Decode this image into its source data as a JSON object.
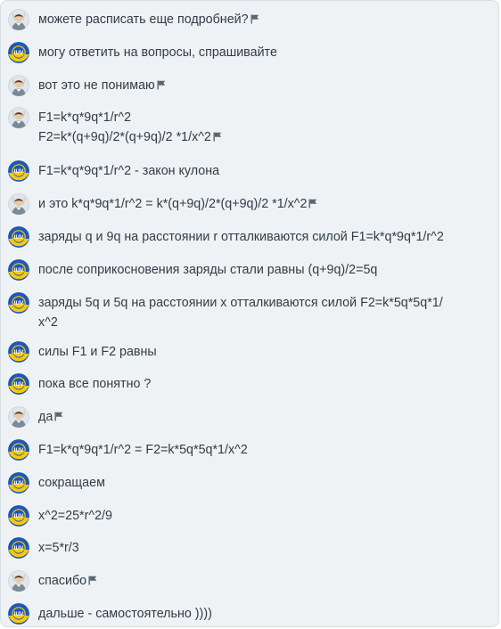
{
  "chat": {
    "messages": [
      {
        "author": "asker",
        "lines": [
          "можете расписать еще подробней?"
        ],
        "flag": true
      },
      {
        "author": "helper",
        "lines": [
          "могу ответить на вопросы, спрашивайте"
        ],
        "flag": false
      },
      {
        "author": "asker",
        "lines": [
          "вот это не понимаю"
        ],
        "flag": true
      },
      {
        "author": "asker",
        "lines": [
          "F1=k*q*9q*1/r^2",
          "F2=k*(q+9q)/2*(q+9q)/2 *1/x^2"
        ],
        "flag": true
      },
      {
        "author": "helper",
        "lines": [
          "F1=k*q*9q*1/r^2 - закон кулона"
        ],
        "flag": false
      },
      {
        "author": "asker",
        "lines": [
          "и это k*q*9q*1/r^2 = k*(q+9q)/2*(q+9q)/2 *1/x^2"
        ],
        "flag": true
      },
      {
        "author": "helper",
        "lines": [
          "заряды q и 9q на расстоянии r отталкиваются силой F1=k*q*9q*1/r^2"
        ],
        "flag": false
      },
      {
        "author": "helper",
        "lines": [
          "после соприкосновения заряды стали равны (q+9q)/2=5q"
        ],
        "flag": false
      },
      {
        "author": "helper",
        "lines": [
          "заряды 5q и 5q на расстоянии x отталкиваются силой F2=k*5q*5q*1/",
          "x^2"
        ],
        "flag": false
      },
      {
        "author": "helper",
        "lines": [
          "силы F1 и F2 равны"
        ],
        "flag": false
      },
      {
        "author": "helper",
        "lines": [
          "пока все понятно ?"
        ],
        "flag": false
      },
      {
        "author": "asker",
        "lines": [
          "да"
        ],
        "flag": true
      },
      {
        "author": "helper",
        "lines": [
          "F1=k*q*9q*1/r^2 = F2=k*5q*5q*1/x^2"
        ],
        "flag": false
      },
      {
        "author": "helper",
        "lines": [
          "сокращаем"
        ],
        "flag": false
      },
      {
        "author": "helper",
        "lines": [
          "x^2=25*r^2/9"
        ],
        "flag": false
      },
      {
        "author": "helper",
        "lines": [
          "x=5*r/3"
        ],
        "flag": false
      },
      {
        "author": "asker",
        "lines": [
          "спасибо"
        ],
        "flag": true
      },
      {
        "author": "helper",
        "lines": [
          "дальше - самостоятельно ))))"
        ],
        "flag": false
      }
    ]
  },
  "icons": {
    "asker_avatar": "student-avatar-icon",
    "helper_avatar": "iuv-badge-avatar-icon",
    "flag": "report-flag-icon"
  },
  "colors": {
    "panel_background": "#eef2f5",
    "text": "#323c45",
    "flag": "#5a6670",
    "badge_blue": "#1f58b5",
    "badge_yellow": "#f6c913"
  }
}
